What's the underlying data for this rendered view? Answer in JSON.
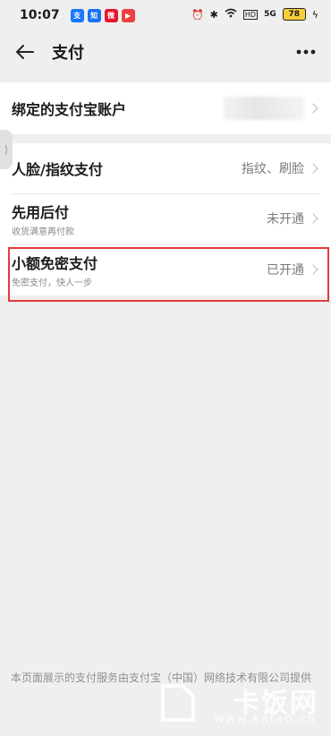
{
  "status_bar": {
    "time": "10:07",
    "apps": [
      {
        "name": "alipay-app-icon",
        "color": "#1677ff",
        "glyph": "支"
      },
      {
        "name": "zhihu-app-icon",
        "color": "#1772f6",
        "glyph": "知"
      },
      {
        "name": "weibo-app-icon",
        "color": "#e6162d",
        "glyph": "微"
      },
      {
        "name": "video-app-icon",
        "color": "#f04142",
        "glyph": "▶"
      }
    ],
    "network_label": "5G",
    "battery": "78"
  },
  "nav": {
    "title": "支付"
  },
  "rows": [
    {
      "label": "绑定的支付宝账户"
    },
    {
      "label": "人脸/指纹支付",
      "value": "指纹、刷脸"
    },
    {
      "label": "先用后付",
      "sub": "收货满意再付款",
      "value": "未开通"
    },
    {
      "label": "小额免密支付",
      "sub": "免密支付，快人一步",
      "value": "已开通"
    }
  ],
  "footer": {
    "text": "本页面展示的支付服务由支付宝（中国）网络技术有限公司提供"
  },
  "watermark": {
    "title": "卡饭网",
    "url": "www.kafan.cn"
  },
  "colors": {
    "highlight": "#e03c3c",
    "background": "#efefef"
  }
}
